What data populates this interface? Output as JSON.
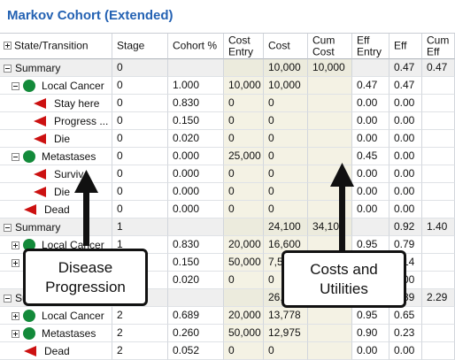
{
  "window": {
    "title": "Markov Cohort (Extended)"
  },
  "columns": [
    {
      "key": "state",
      "label": "State/Transition",
      "has_expander": true
    },
    {
      "key": "stage",
      "label": "Stage"
    },
    {
      "key": "cohort",
      "label": "Cohort %"
    },
    {
      "key": "cost_entry",
      "label": "Cost\nEntry"
    },
    {
      "key": "cost",
      "label": "Cost"
    },
    {
      "key": "cum_cost",
      "label": "Cum\nCost"
    },
    {
      "key": "eff_entry",
      "label": "Eff\nEntry"
    },
    {
      "key": "eff",
      "label": "Eff"
    },
    {
      "key": "cum_eff",
      "label": "Cum\nEff"
    }
  ],
  "rows": [
    {
      "type": "summary",
      "icon": "minus",
      "label": "Summary",
      "stage": "0",
      "cohort": "",
      "cost_entry": "",
      "cost": "10,000",
      "cum_cost": "10,000",
      "eff_entry": "",
      "eff": "0.47",
      "cum_eff": "0.47"
    },
    {
      "type": "state",
      "icon": "minus",
      "label": "Local Cancer",
      "stage": "0",
      "cohort": "1.000",
      "cost_entry": "10,000",
      "cost": "10,000",
      "cum_cost": "",
      "eff_entry": "0.47",
      "eff": "0.47",
      "cum_eff": ""
    },
    {
      "type": "transition",
      "label": "Stay here",
      "stage": "0",
      "cohort": "0.830",
      "cost_entry": "0",
      "cost": "0",
      "cum_cost": "",
      "eff_entry": "0.00",
      "eff": "0.00",
      "cum_eff": ""
    },
    {
      "type": "transition",
      "label": "Progress ...",
      "stage": "0",
      "cohort": "0.150",
      "cost_entry": "0",
      "cost": "0",
      "cum_cost": "",
      "eff_entry": "0.00",
      "eff": "0.00",
      "cum_eff": ""
    },
    {
      "type": "transition",
      "label": "Die",
      "stage": "0",
      "cohort": "0.020",
      "cost_entry": "0",
      "cost": "0",
      "cum_cost": "",
      "eff_entry": "0.00",
      "eff": "0.00",
      "cum_eff": ""
    },
    {
      "type": "state",
      "icon": "minus",
      "label": "Metastases",
      "stage": "0",
      "cohort": "0.000",
      "cost_entry": "25,000",
      "cost": "0",
      "cum_cost": "",
      "eff_entry": "0.45",
      "eff": "0.00",
      "cum_eff": ""
    },
    {
      "type": "transition",
      "label": "Surviv",
      "stage": "0",
      "cohort": "0.000",
      "cost_entry": "0",
      "cost": "0",
      "cum_cost": "",
      "eff_entry": "0.00",
      "eff": "0.00",
      "cum_eff": ""
    },
    {
      "type": "transition",
      "label": "Die",
      "stage": "0",
      "cohort": "0.000",
      "cost_entry": "0",
      "cost": "0",
      "cum_cost": "",
      "eff_entry": "0.00",
      "eff": "0.00",
      "cum_eff": ""
    },
    {
      "type": "absorbing",
      "label": "Dead",
      "stage": "0",
      "cohort": "0.000",
      "cost_entry": "0",
      "cost": "0",
      "cum_cost": "",
      "eff_entry": "0.00",
      "eff": "0.00",
      "cum_eff": ""
    },
    {
      "type": "summary",
      "icon": "minus",
      "label": "Summary",
      "stage": "1",
      "cohort": "",
      "cost_entry": "",
      "cost": "24,100",
      "cum_cost": "34,100",
      "eff_entry": "",
      "eff": "0.92",
      "cum_eff": "1.40"
    },
    {
      "type": "state",
      "icon": "plus",
      "label": "Local Cancer",
      "stage": "1",
      "cohort": "0.830",
      "cost_entry": "20,000",
      "cost": "16,600",
      "cum_cost": "",
      "eff_entry": "0.95",
      "eff": "0.79",
      "cum_eff": ""
    },
    {
      "type": "state",
      "icon": "plus",
      "label": "Metastases",
      "stage": "1",
      "cohort": "0.150",
      "cost_entry": "50,000",
      "cost": "7,500",
      "cum_cost": "",
      "eff_entry": "0.90",
      "eff": "0.14",
      "cum_eff": ""
    },
    {
      "type": "absorbing",
      "label": "Dead",
      "stage": "1",
      "cohort": "0.020",
      "cost_entry": "0",
      "cost": "0",
      "cum_cost": "",
      "eff_entry": "0.00",
      "eff": "0.00",
      "cum_eff": ""
    },
    {
      "type": "summary",
      "icon": "minus",
      "label": "Summary",
      "stage": "2",
      "cohort": "",
      "cost_entry": "",
      "cost": "26,753",
      "cum_cost": "60,853",
      "eff_entry": "",
      "eff": "0.89",
      "cum_eff": "2.29"
    },
    {
      "type": "state",
      "icon": "plus",
      "label": "Local Cancer",
      "stage": "2",
      "cohort": "0.689",
      "cost_entry": "20,000",
      "cost": "13,778",
      "cum_cost": "",
      "eff_entry": "0.95",
      "eff": "0.65",
      "cum_eff": ""
    },
    {
      "type": "state",
      "icon": "plus",
      "label": "Metastases",
      "stage": "2",
      "cohort": "0.260",
      "cost_entry": "50,000",
      "cost": "12,975",
      "cum_cost": "",
      "eff_entry": "0.90",
      "eff": "0.23",
      "cum_eff": ""
    },
    {
      "type": "absorbing",
      "label": "Dead",
      "stage": "2",
      "cohort": "0.052",
      "cost_entry": "0",
      "cost": "0",
      "cum_cost": "",
      "eff_entry": "0.00",
      "eff": "0.00",
      "cum_eff": ""
    }
  ],
  "annotations": [
    {
      "id": "disease",
      "text": "Disease\nProgression"
    },
    {
      "id": "costs",
      "text": "Costs and\nUtilities"
    }
  ],
  "colors": {
    "title": "#2462b3",
    "state_node": "#138a3a",
    "transition_node": "#cc1111",
    "cost_column_bg": "#f4f2e4",
    "summary_bg": "#efefef"
  }
}
